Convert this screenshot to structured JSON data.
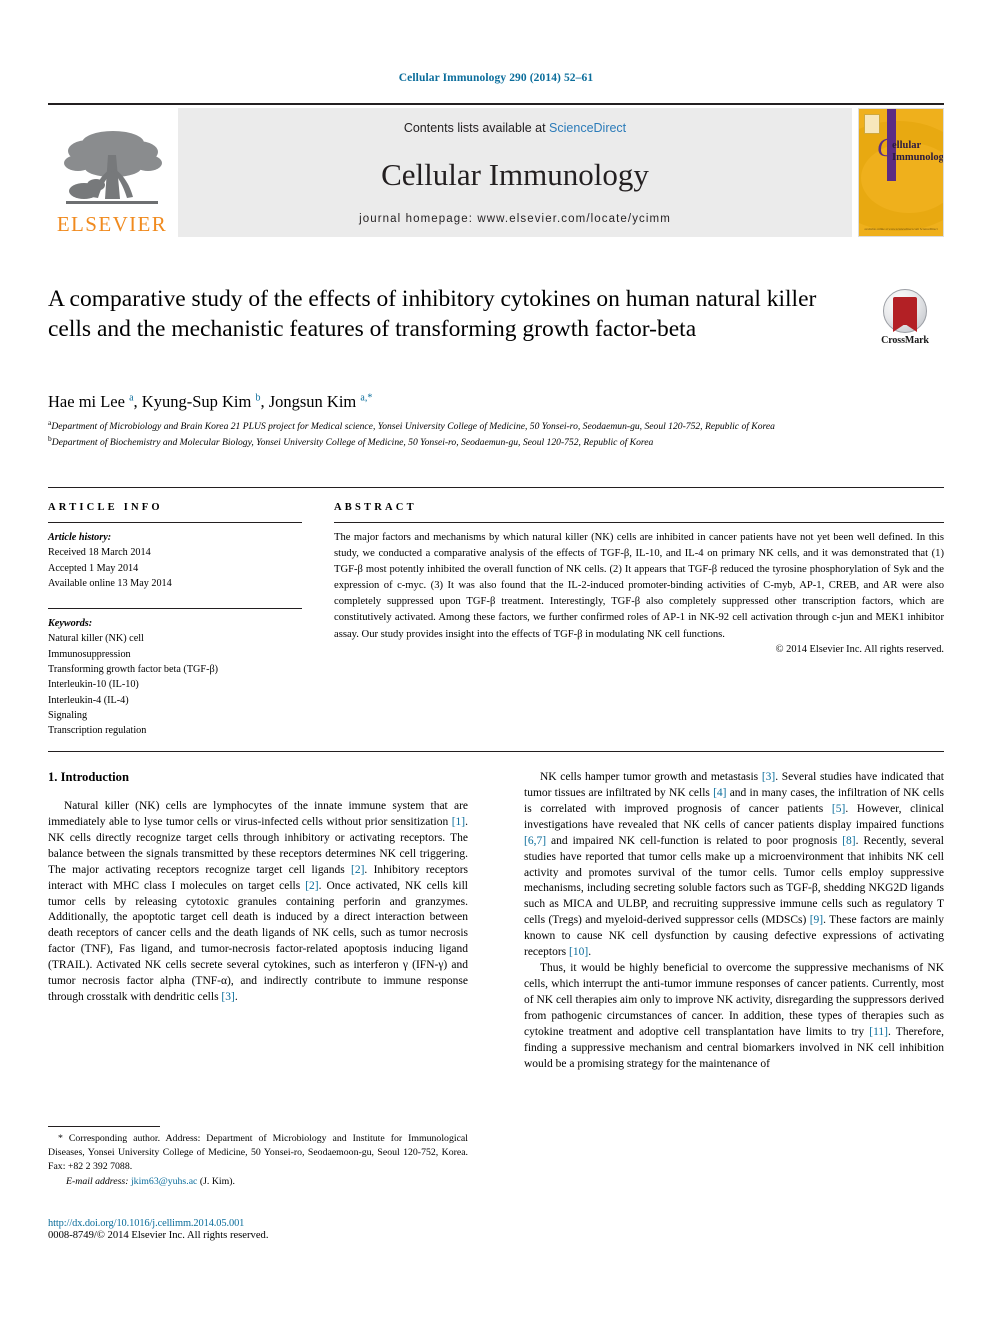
{
  "running_head": "Cellular Immunology 290 (2014) 52–61",
  "masthead": {
    "publisher_name": "ELSEVIER",
    "contents_prefix": "Contents lists available at ",
    "contents_link": "ScienceDirect",
    "journal_name": "Cellular Immunology",
    "homepage": "journal homepage: www.elsevier.com/locate/ycimm",
    "cover": {
      "letter": "C",
      "title_line1": "ellular",
      "title_line2": "Immunology",
      "footer": "available online at www.sciencedirect.com\nScienceDirect"
    },
    "colors": {
      "band_background": "#ebebeb",
      "elsevier_orange": "#f08a1e",
      "link_blue": "#2b7bb9",
      "cover_gold": "#efb01c",
      "cover_purple": "#5b2d84"
    }
  },
  "article": {
    "title": "A comparative study of the effects of inhibitory cytokines on human natural killer cells and the mechanistic features of transforming growth factor-beta",
    "crossmark_label": "CrossMark",
    "authors_html": "Hae mi Lee <sup>a</sup>, Kyung-Sup Kim <sup>b</sup>, Jongsun Kim <sup>a,*</sup>",
    "affiliations": [
      {
        "marker": "a",
        "text": "Department of Microbiology and Brain Korea 21 PLUS project for Medical science, Yonsei University College of Medicine, 50 Yonsei-ro, Seodaemun-gu, Seoul 120-752, Republic of Korea"
      },
      {
        "marker": "b",
        "text": "Department of Biochemistry and Molecular Biology, Yonsei University College of Medicine, 50 Yonsei-ro, Seodaemun-gu, Seoul 120-752, Republic of Korea"
      }
    ]
  },
  "article_info": {
    "heading": "ARTICLE INFO",
    "history_label": "Article history:",
    "history": [
      "Received 18 March 2014",
      "Accepted 1 May 2014",
      "Available online 13 May 2014"
    ],
    "keywords_label": "Keywords:",
    "keywords": [
      "Natural killer (NK) cell",
      "Immunosuppression",
      "Transforming growth factor beta (TGF-β)",
      "Interleukin-10 (IL-10)",
      "Interleukin-4 (IL-4)",
      "Signaling",
      "Transcription regulation"
    ]
  },
  "abstract": {
    "heading": "ABSTRACT",
    "text": "The major factors and mechanisms by which natural killer (NK) cells are inhibited in cancer patients have not yet been well defined. In this study, we conducted a comparative analysis of the effects of TGF-β, IL-10, and IL-4 on primary NK cells, and it was demonstrated that (1) TGF-β most potently inhibited the overall function of NK cells. (2) It appears that TGF-β reduced the tyrosine phosphorylation of Syk and the expression of c-myc. (3) It was also found that the IL-2-induced promoter-binding activities of C-myb, AP-1, CREB, and AR were also completely suppressed upon TGF-β treatment. Interestingly, TGF-β also completely suppressed other transcription factors, which are constitutively activated. Among these factors, we further confirmed roles of AP-1 in NK-92 cell activation through c-jun and MEK1 inhibitor assay. Our study provides insight into the effects of TGF-β in modulating NK cell functions.",
    "copyright": "© 2014 Elsevier Inc. All rights reserved."
  },
  "body": {
    "section_heading": "1. Introduction",
    "left_paragraphs": [
      "Natural killer (NK) cells are lymphocytes of the innate immune system that are immediately able to lyse tumor cells or virus-infected cells without prior sensitization [1]. NK cells directly recognize target cells through inhibitory or activating receptors. The balance between the signals transmitted by these receptors determines NK cell triggering. The major activating receptors recognize target cell ligands [2]. Inhibitory receptors interact with MHC class I molecules on target cells [2]. Once activated, NK cells kill tumor cells by releasing cytotoxic granules containing perforin and granzymes. Additionally, the apoptotic target cell death is induced by a direct interaction between death receptors of cancer cells and the death ligands of NK cells, such as tumor necrosis factor (TNF), Fas ligand, and tumor-necrosis factor-related apoptosis inducing ligand (TRAIL). Activated NK cells secrete several cytokines, such as interferon γ (IFN-γ) and tumor necrosis factor alpha (TNF-α), and indirectly contribute to immune response through crosstalk with dendritic cells [3]."
    ],
    "right_paragraphs": [
      "NK cells hamper tumor growth and metastasis [3]. Several studies have indicated that tumor tissues are infiltrated by NK cells [4] and in many cases, the infiltration of NK cells is correlated with improved prognosis of cancer patients [5]. However, clinical investigations have revealed that NK cells of cancer patients display impaired functions [6,7] and impaired NK cell-function is related to poor prognosis [8]. Recently, several studies have reported that tumor cells make up a microenvironment that inhibits NK cell activity and promotes survival of the tumor cells. Tumor cells employ suppressive mechanisms, including secreting soluble factors such as TGF-β, shedding NKG2D ligands such as MICA and ULBP, and recruiting suppressive immune cells such as regulatory T cells (Tregs) and myeloid-derived suppressor cells (MDSCs) [9]. These factors are mainly known to cause NK cell dysfunction by causing defective expressions of activating receptors [10].",
      "Thus, it would be highly beneficial to overcome the suppressive mechanisms of NK cells, which interrupt the anti-tumor immune responses of cancer patients. Currently, most of NK cell therapies aim only to improve NK activity, disregarding the suppressors derived from pathogenic circumstances of cancer. In addition, these types of therapies such as cytokine treatment and adoptive cell transplantation have limits to try [11]. Therefore, finding a suppressive mechanism and central biomarkers involved in NK cell inhibition would be a promising strategy for the maintenance of"
    ],
    "reference_color": "#0b6d9b"
  },
  "footnote": {
    "text": "* Corresponding author. Address: Department of Microbiology and Institute for Immunological Diseases, Yonsei University College of Medicine, 50 Yonsei-ro, Seodaemoon-gu, Seoul 120-752, Korea. Fax: +82 2 392 7088.",
    "email_label": "E-mail address:",
    "email": "jkim63@yuhs.ac",
    "email_suffix": "(J. Kim)."
  },
  "page_footer": {
    "doi": "http://dx.doi.org/10.1016/j.cellimm.2014.05.001",
    "issn_line": "0008-8749/© 2014 Elsevier Inc. All rights reserved."
  }
}
